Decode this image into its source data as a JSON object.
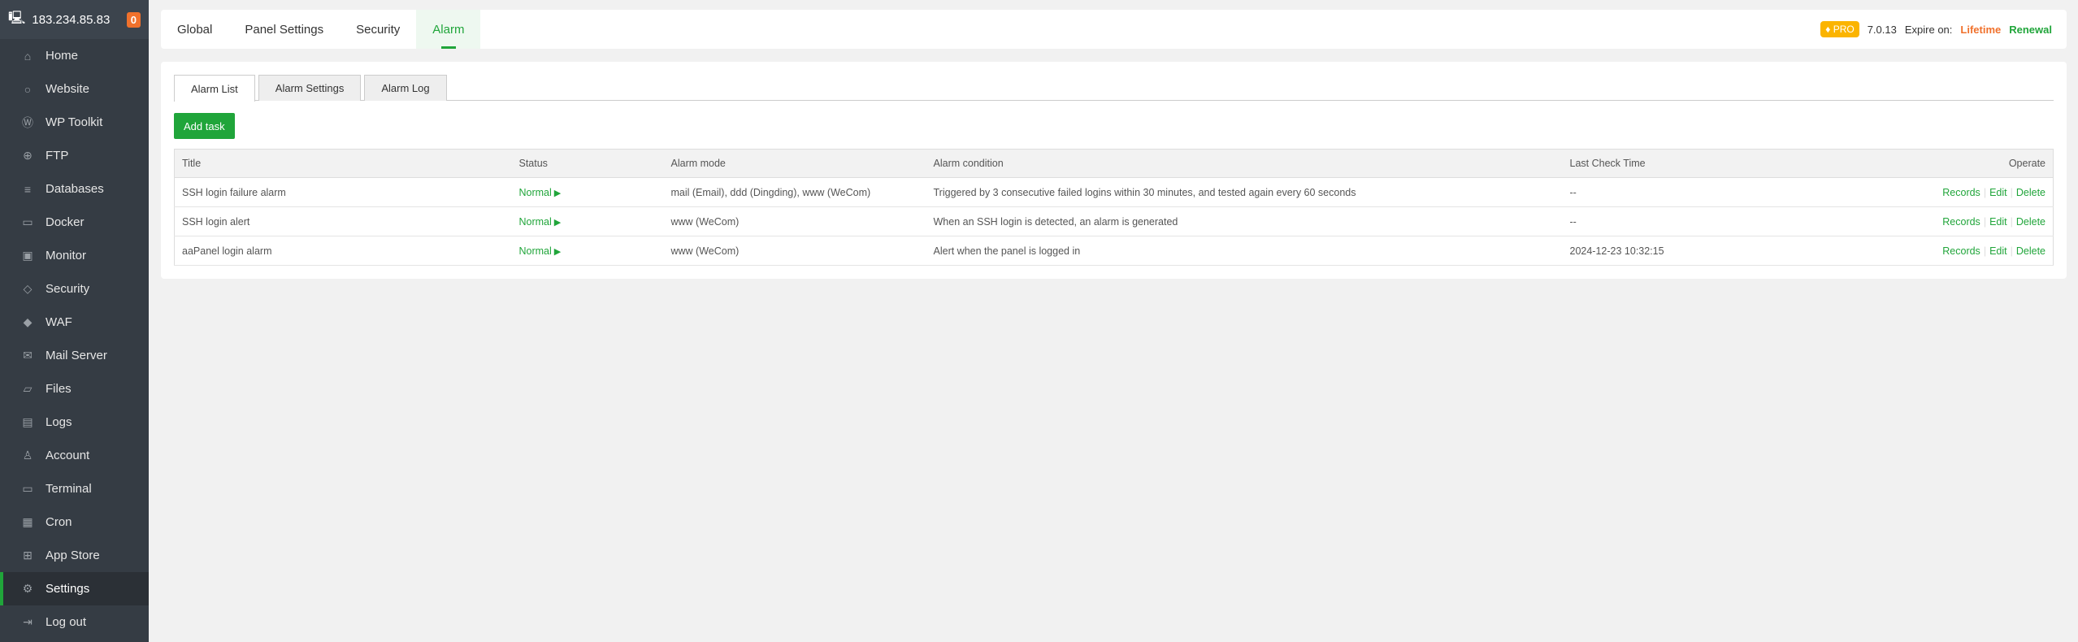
{
  "sidebar": {
    "ip": "183.234.85.83",
    "badge": "0",
    "items": [
      {
        "label": "Home",
        "icon": "home-icon",
        "g": "⌂"
      },
      {
        "label": "Website",
        "icon": "globe-icon",
        "g": "○"
      },
      {
        "label": "WP Toolkit",
        "icon": "wordpress-icon",
        "g": "Ⓦ"
      },
      {
        "label": "FTP",
        "icon": "ftp-icon",
        "g": "⊕"
      },
      {
        "label": "Databases",
        "icon": "database-icon",
        "g": "≡"
      },
      {
        "label": "Docker",
        "icon": "docker-icon",
        "g": "▭"
      },
      {
        "label": "Monitor",
        "icon": "monitor-icon",
        "g": "▣"
      },
      {
        "label": "Security",
        "icon": "shield-icon",
        "g": "◇"
      },
      {
        "label": "WAF",
        "icon": "waf-shield-icon",
        "g": "◆"
      },
      {
        "label": "Mail Server",
        "icon": "mail-icon",
        "g": "✉"
      },
      {
        "label": "Files",
        "icon": "folder-icon",
        "g": "▱"
      },
      {
        "label": "Logs",
        "icon": "logs-icon",
        "g": "▤"
      },
      {
        "label": "Account",
        "icon": "user-icon",
        "g": "♙"
      },
      {
        "label": "Terminal",
        "icon": "terminal-icon",
        "g": "▭"
      },
      {
        "label": "Cron",
        "icon": "calendar-icon",
        "g": "▦"
      },
      {
        "label": "App Store",
        "icon": "apps-icon",
        "g": "⊞"
      },
      {
        "label": "Settings",
        "icon": "gear-icon",
        "g": "⚙",
        "active": true
      },
      {
        "label": "Log out",
        "icon": "logout-icon",
        "g": "⇥"
      }
    ]
  },
  "nav": {
    "tabs": [
      "Global",
      "Panel Settings",
      "Security",
      "Alarm"
    ],
    "pro": "PRO",
    "version": "7.0.13",
    "expire_label": "Expire on:",
    "expire_value": "Lifetime",
    "renewal": "Renewal"
  },
  "subtabs": [
    "Alarm List",
    "Alarm Settings",
    "Alarm Log"
  ],
  "add_task": "Add task",
  "table": {
    "headers": [
      "Title",
      "Status",
      "Alarm mode",
      "Alarm condition",
      "Last Check Time",
      "Operate"
    ],
    "rows": [
      {
        "title": "SSH login failure alarm",
        "status": "Normal",
        "mode": "mail (Email), ddd (Dingding), www (WeCom)",
        "condition": "Triggered by 3 consecutive failed logins within 30 minutes, and tested again every 60 seconds",
        "last": "--"
      },
      {
        "title": "SSH login alert",
        "status": "Normal",
        "mode": "www (WeCom)",
        "condition": "When an SSH login is detected, an alarm is generated",
        "last": "--"
      },
      {
        "title": "aaPanel login alarm",
        "status": "Normal",
        "mode": "www (WeCom)",
        "condition": "Alert when the panel is logged in",
        "last": "2024-12-23 10:32:15"
      }
    ],
    "ops": [
      "Records",
      "Edit",
      "Delete"
    ]
  },
  "colors": {
    "accent": "#20a53a",
    "orange": "#f0712c",
    "pro": "#fbb400"
  }
}
